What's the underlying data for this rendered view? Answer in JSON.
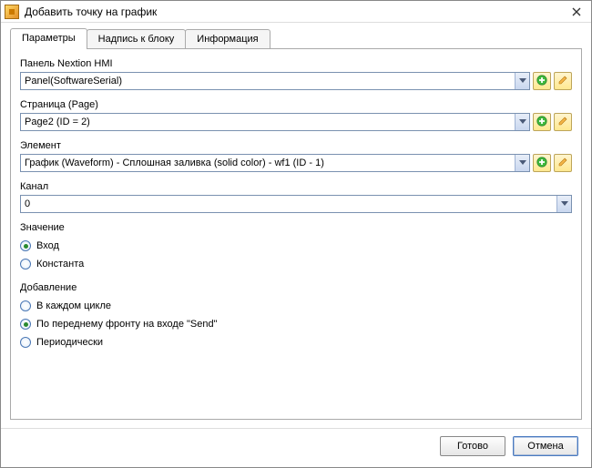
{
  "window": {
    "title": "Добавить точку на график"
  },
  "tabs": [
    {
      "label": "Параметры",
      "active": true
    },
    {
      "label": "Надпись к блоку",
      "active": false
    },
    {
      "label": "Информация",
      "active": false
    }
  ],
  "panel": {
    "label": "Панель Nextion HMI",
    "value": "Panel(SoftwareSerial)"
  },
  "page": {
    "label": "Страница (Page)",
    "value": "Page2 (ID = 2)"
  },
  "element": {
    "label": "Элемент",
    "value": "График (Waveform) - Сплошная заливка (solid color) - wf1 (ID - 1)"
  },
  "channel": {
    "label": "Канал",
    "value": "0"
  },
  "value_source": {
    "label": "Значение",
    "options": [
      {
        "label": "Вход",
        "checked": true
      },
      {
        "label": "Константа",
        "checked": false
      }
    ]
  },
  "add_mode": {
    "label": "Добавление",
    "options": [
      {
        "label": "В каждом цикле",
        "checked": false
      },
      {
        "label": "По переднему фронту на входе \"Send\"",
        "checked": true
      },
      {
        "label": "Периодически",
        "checked": false
      }
    ]
  },
  "footer": {
    "ok": "Готово",
    "cancel": "Отмена"
  },
  "icons": {
    "add": "add-icon",
    "edit": "edit-icon",
    "dropdown": "chevron-down-icon",
    "close": "close-icon",
    "app": "app-icon"
  }
}
